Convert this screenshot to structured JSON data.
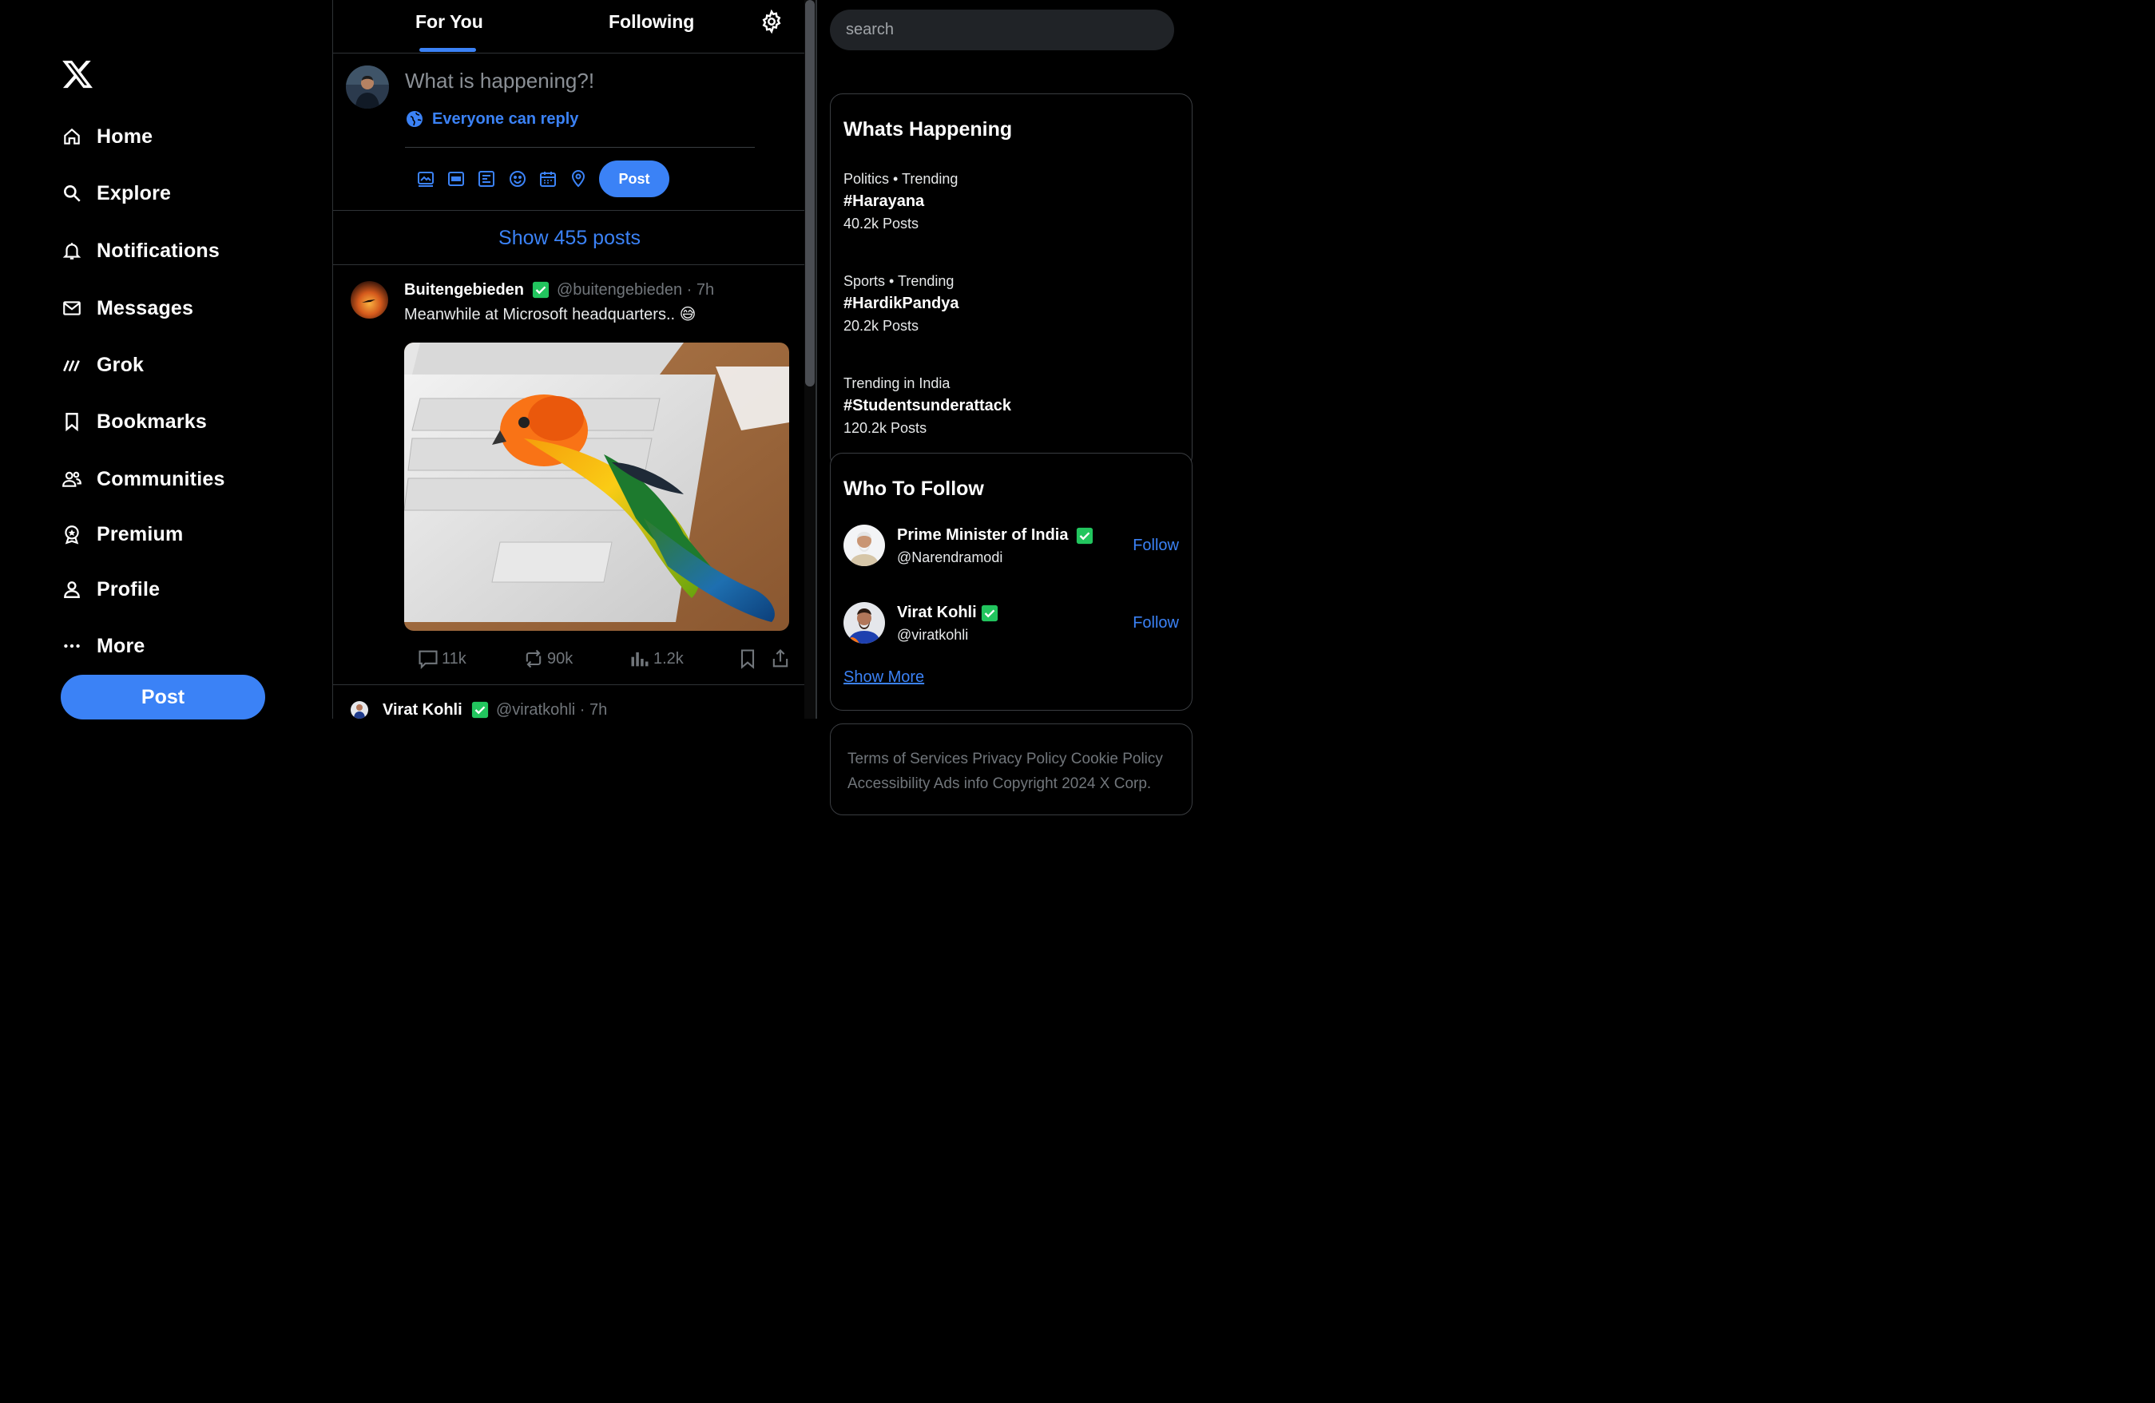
{
  "nav": {
    "logo": "x-logo-icon",
    "items": [
      {
        "label": "Home",
        "icon": "home-icon"
      },
      {
        "label": "Explore",
        "icon": "search-icon"
      },
      {
        "label": "Notifications",
        "icon": "bell-icon"
      },
      {
        "label": "Messages",
        "icon": "mail-icon"
      },
      {
        "label": "Grok",
        "icon": "grok-icon"
      },
      {
        "label": "Bookmarks",
        "icon": "bookmark-icon"
      },
      {
        "label": "Communities",
        "icon": "communities-icon"
      },
      {
        "label": "Premium",
        "icon": "premium-icon"
      },
      {
        "label": "Profile",
        "icon": "person-icon"
      },
      {
        "label": "More",
        "icon": "more-icon"
      }
    ],
    "post_label": "Post"
  },
  "feed": {
    "tabs": [
      "For You",
      "Following"
    ],
    "active_tab": "For You",
    "compose": {
      "placeholder": "What is happening?!",
      "reply_setting": "Everyone can reply",
      "post_label": "Post",
      "tools": [
        "media-icon",
        "gif-icon",
        "poll-icon",
        "emoji-icon",
        "schedule-icon",
        "location-icon"
      ]
    },
    "show_posts": "Show 455 posts",
    "posts": [
      {
        "name": "Buitengebieden",
        "handle": "@buitengebieden · 7h",
        "text": "Meanwhile at Microsoft headquarters.. 😅",
        "image": "parrot sleeping on laptop keyboard",
        "replies": "11k",
        "reposts": "90k",
        "views": "1.2k"
      },
      {
        "name": "Virat Kohli",
        "handle": "@viratkohli · 7h"
      }
    ]
  },
  "sidebar": {
    "search_placeholder": "search",
    "whats_happening": {
      "title": "Whats Happening",
      "trends": [
        {
          "meta": "Politics • Trending",
          "tag": "#Harayana",
          "count": "40.2k Posts"
        },
        {
          "meta": "Sports • Trending",
          "tag": "#HardikPandya",
          "count": "20.2k Posts"
        },
        {
          "meta": "Trending in India",
          "tag": "#Studentsunderattack",
          "count": "120.2k Posts"
        }
      ]
    },
    "who_to_follow": {
      "title": "Who To Follow",
      "accounts": [
        {
          "name": "Prime Minister of India",
          "handle": "@Narendramodi",
          "follow": "Follow"
        },
        {
          "name": "Virat Kohli",
          "handle": "@viratkohli",
          "follow": "Follow"
        }
      ],
      "show_more": "Show More"
    },
    "footer": "Terms of Services Privacy Policy Cookie Policy Accessibility Ads info Copyright 2024 X Corp."
  },
  "colors": {
    "accent": "#3b82f6",
    "verified": "#22c55e",
    "muted": "#71767b",
    "border": "#2f3336"
  }
}
